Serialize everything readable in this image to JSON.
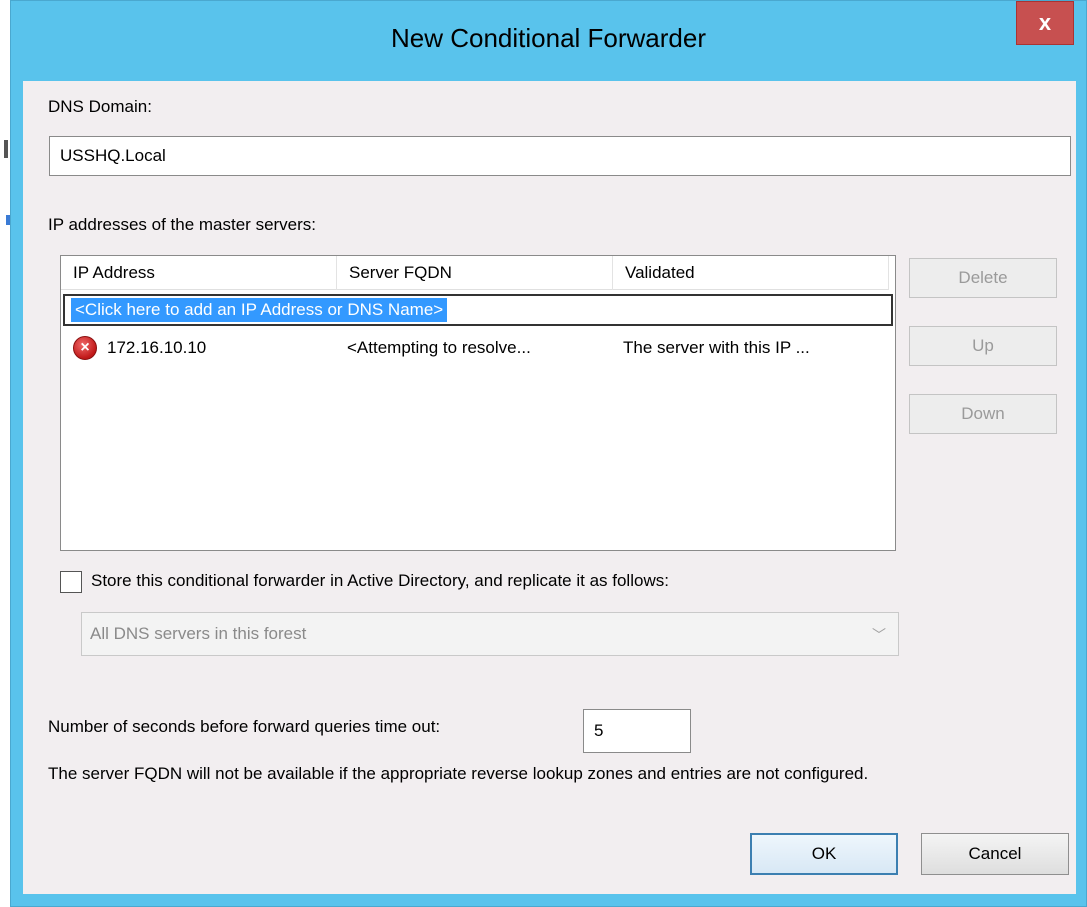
{
  "dialog": {
    "title": "New Conditional Forwarder",
    "close_label": "x"
  },
  "dns_domain": {
    "label": "DNS Domain:",
    "value": "USSHQ.Local"
  },
  "master_servers": {
    "label": "IP addresses of the master servers:",
    "columns": [
      "IP Address",
      "Server FQDN",
      "Validated"
    ],
    "add_row_text": "<Click here to add an IP Address or DNS Name>",
    "rows": [
      {
        "status_icon": "error-icon",
        "ip": "172.16.10.10",
        "fqdn": "<Attempting to resolve...",
        "validated": "The server with this IP ..."
      }
    ]
  },
  "side_buttons": {
    "delete": "Delete",
    "up": "Up",
    "down": "Down"
  },
  "store_in_ad": {
    "checked": false,
    "label": "Store this conditional forwarder in Active Directory, and replicate it as follows:"
  },
  "replication_scope": {
    "selected": "All DNS servers in this forest"
  },
  "timeout": {
    "label": "Number of seconds before forward queries time out:",
    "value": "5"
  },
  "note": "The server FQDN will not be available if the appropriate reverse lookup zones and entries are not configured.",
  "footer": {
    "ok": "OK",
    "cancel": "Cancel"
  },
  "colors": {
    "title_bar": "#59c3ec",
    "close_button": "#c75050",
    "selection": "#3399ff",
    "error": "#c01818"
  }
}
